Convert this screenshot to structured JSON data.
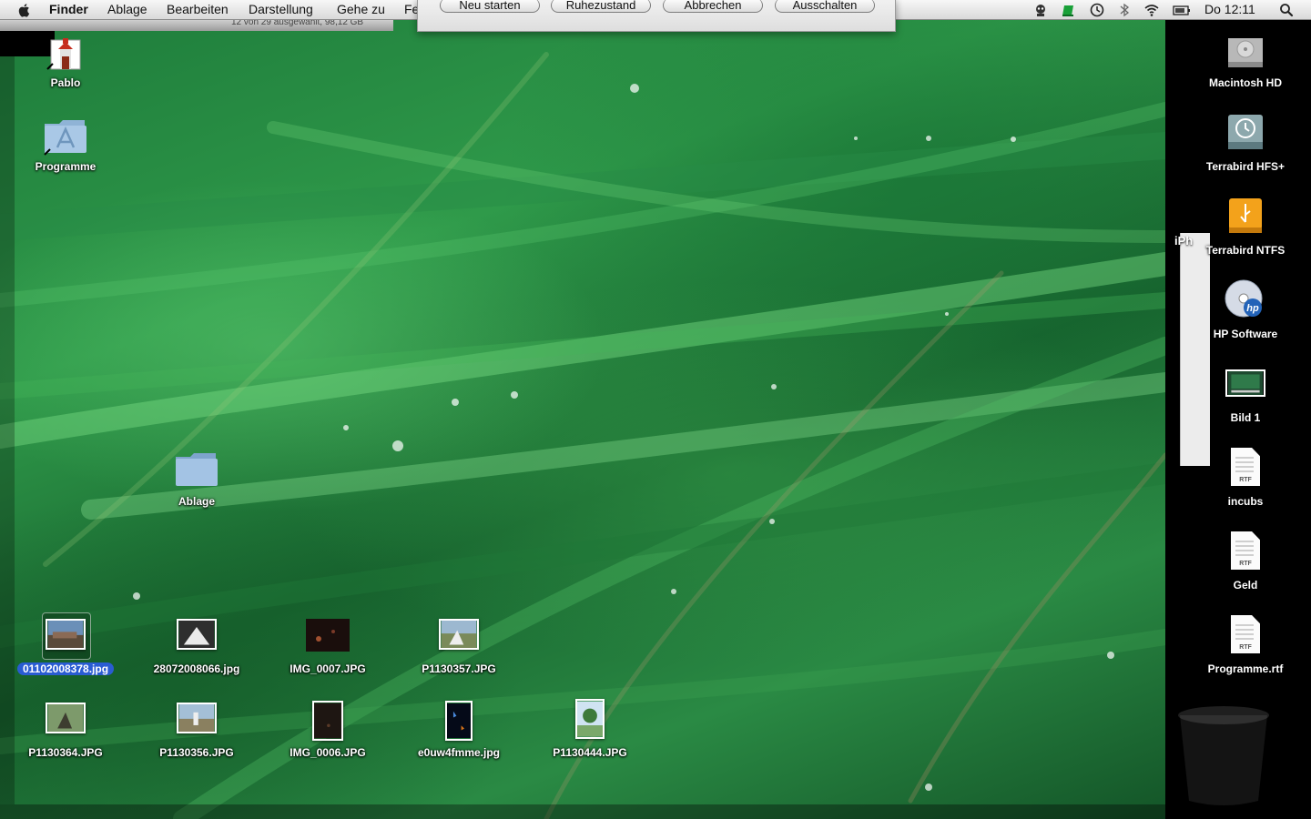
{
  "menubar": {
    "app_name": "Finder",
    "menus": [
      "Ablage",
      "Bearbeiten",
      "Darstellung",
      "Gehe zu",
      "Fe"
    ],
    "clock": "Do 12:11",
    "status_icons": [
      "robot-icon",
      "green-flag-icon",
      "time-machine-icon",
      "bluetooth-icon",
      "wifi-icon",
      "battery-icon",
      "spotlight-icon"
    ]
  },
  "finder_strip": {
    "status_text": "12 von 29 ausgewählt, 98,12 GB"
  },
  "dialog": {
    "buttons": [
      "Neu starten",
      "Ruhezustand",
      "Abbrechen",
      "Ausschalten"
    ]
  },
  "partial_window": {
    "label": "iPh"
  },
  "desktop_left": {
    "pablo": "Pablo",
    "programme": "Programme",
    "ablage": "Ablage"
  },
  "photos_row1": [
    "01102008378.jpg",
    "28072008066.jpg",
    "IMG_0007.JPG",
    "P1130357.JPG"
  ],
  "photos_row2": [
    "P1130364.JPG",
    "P1130356.JPG",
    "IMG_0006.JPG",
    "e0uw4fmme.jpg",
    "P1130444.JPG"
  ],
  "desktop_right": [
    "Macintosh HD",
    "Terrabird HFS+",
    "Terrabird NTFS",
    "HP Software",
    "Bild 1",
    "incubs",
    "Geld",
    "Programme.rtf"
  ],
  "file_tags": {
    "rtf": "RTF"
  },
  "colors": {
    "selection": "#2a5cd2",
    "menubar": "#e6e6e6",
    "wallpaper_green": "#2a8a44"
  }
}
